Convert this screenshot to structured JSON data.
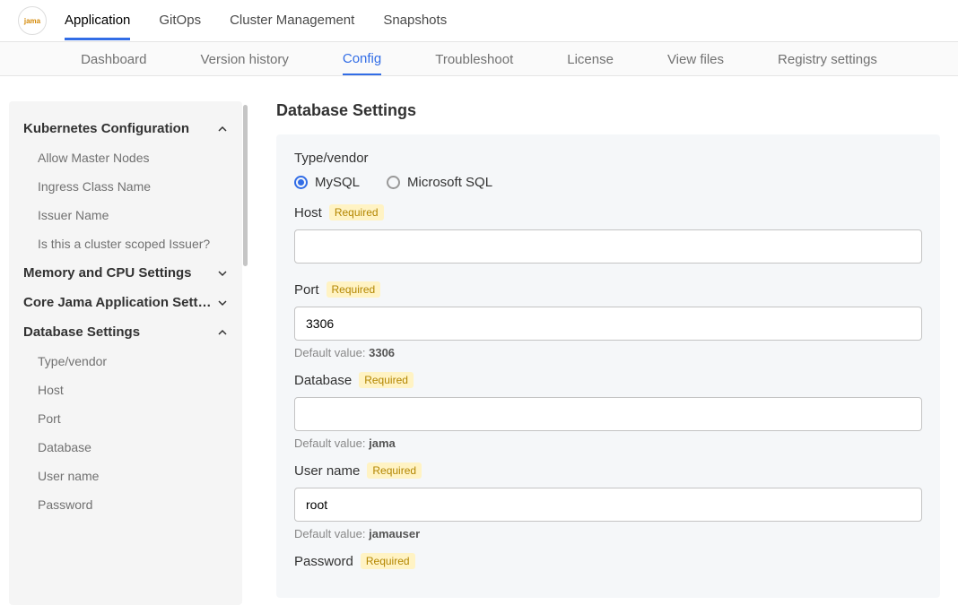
{
  "topnav": {
    "logo_text": "jama",
    "items": [
      {
        "label": "Application",
        "active": true
      },
      {
        "label": "GitOps",
        "active": false
      },
      {
        "label": "Cluster Management",
        "active": false
      },
      {
        "label": "Snapshots",
        "active": false
      }
    ]
  },
  "subnav": {
    "items": [
      {
        "label": "Dashboard",
        "active": false
      },
      {
        "label": "Version history",
        "active": false
      },
      {
        "label": "Config",
        "active": true
      },
      {
        "label": "Troubleshoot",
        "active": false
      },
      {
        "label": "License",
        "active": false
      },
      {
        "label": "View files",
        "active": false
      },
      {
        "label": "Registry settings",
        "active": false
      }
    ]
  },
  "sidebar": {
    "sections": [
      {
        "title": "Kubernetes Configuration",
        "expanded": true,
        "items": [
          "Allow Master Nodes",
          "Ingress Class Name",
          "Issuer Name",
          "Is this a cluster scoped Issuer?"
        ]
      },
      {
        "title": "Memory and CPU Settings",
        "expanded": false,
        "items": []
      },
      {
        "title": "Core Jama Application Setti…",
        "expanded": false,
        "items": []
      },
      {
        "title": "Database Settings",
        "expanded": true,
        "items": [
          "Type/vendor",
          "Host",
          "Port",
          "Database",
          "User name",
          "Password"
        ]
      }
    ]
  },
  "main": {
    "title": "Database Settings",
    "type_vendor": {
      "label": "Type/vendor",
      "options": [
        {
          "name": "mysql",
          "label": "MySQL",
          "checked": true
        },
        {
          "name": "mssql",
          "label": "Microsoft SQL",
          "checked": false
        }
      ]
    },
    "required_badge": "Required",
    "default_prefix": "Default value: ",
    "fields": {
      "host": {
        "label": "Host",
        "value": "",
        "default": ""
      },
      "port": {
        "label": "Port",
        "value": "3306",
        "default": "3306"
      },
      "database": {
        "label": "Database",
        "value": "",
        "default": "jama"
      },
      "username": {
        "label": "User name",
        "value": "root",
        "default": "jamauser"
      },
      "password": {
        "label": "Password",
        "value": "",
        "default": ""
      }
    }
  }
}
